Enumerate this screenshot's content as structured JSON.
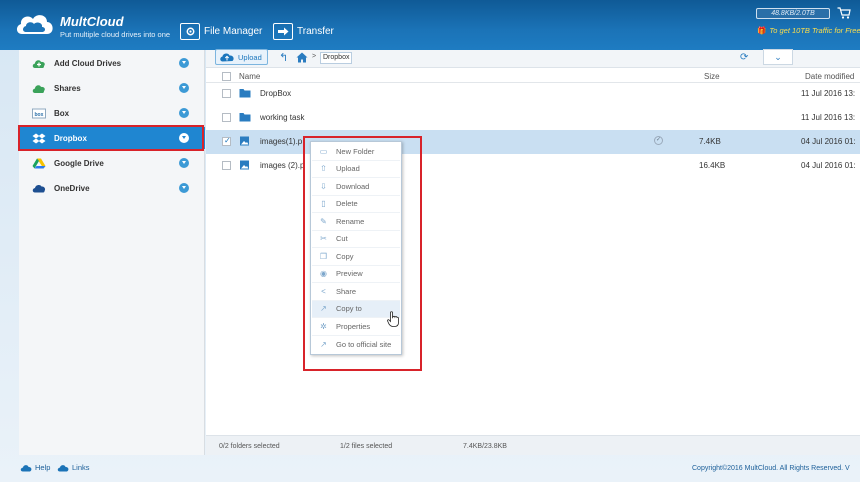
{
  "header": {
    "brand": "MultCloud",
    "tagline": "Put multiple cloud drives into one",
    "nav": [
      {
        "label": "File Manager"
      },
      {
        "label": "Transfer"
      }
    ],
    "quota": "48.8KB/2.0TB",
    "promo": "To get 10TB Traffic for Free"
  },
  "sidebar": {
    "items": [
      {
        "label": "Add Cloud Drives"
      },
      {
        "label": "Shares"
      },
      {
        "label": "Box"
      },
      {
        "label": "Dropbox"
      },
      {
        "label": "Google Drive"
      },
      {
        "label": "OneDrive"
      }
    ]
  },
  "toolbar": {
    "upload_label": "Upload",
    "breadcrumb": "Dropbox"
  },
  "columns": {
    "name": "Name",
    "size": "Size",
    "date": "Date modified"
  },
  "files": [
    {
      "name": "DropBox",
      "size": "",
      "date": "11 Jul 2016 13:",
      "checked": false
    },
    {
      "name": "working task",
      "size": "",
      "date": "11 Jul 2016 13:",
      "checked": false
    },
    {
      "name": "images(1).p",
      "size": "7.4KB",
      "date": "04 Jul 2016 01:",
      "checked": true
    },
    {
      "name": "images (2).p",
      "size": "16.4KB",
      "date": "04 Jul 2016 01:",
      "checked": false
    }
  ],
  "context_menu": {
    "items": [
      {
        "label": "New Folder",
        "icon": "folder-icon"
      },
      {
        "label": "Upload",
        "icon": "upload-icon"
      },
      {
        "label": "Download",
        "icon": "download-icon"
      },
      {
        "label": "Delete",
        "icon": "trash-icon"
      },
      {
        "label": "Rename",
        "icon": "pencil-icon"
      },
      {
        "label": "Cut",
        "icon": "scissors-icon"
      },
      {
        "label": "Copy",
        "icon": "copy-icon"
      },
      {
        "label": "Preview",
        "icon": "eye-icon"
      },
      {
        "label": "Share",
        "icon": "share-icon"
      },
      {
        "label": "Copy to",
        "icon": "copy-to-icon"
      },
      {
        "label": "Properties",
        "icon": "gear-icon"
      },
      {
        "label": "Go to official site",
        "icon": "external-link-icon"
      }
    ]
  },
  "status": {
    "folders": "0/2 folders selected",
    "files": "1/2 files selected",
    "size": "7.4KB/23.8KB"
  },
  "footer": {
    "help": "Help",
    "links": "Links",
    "copyright": "Copyright©2016 MultCloud. All Rights Reserved. V"
  },
  "colors": {
    "header": "#1b73b7",
    "accent": "#1f86d1",
    "highlight": "#d8232a",
    "selected_row": "#c9dff2"
  }
}
